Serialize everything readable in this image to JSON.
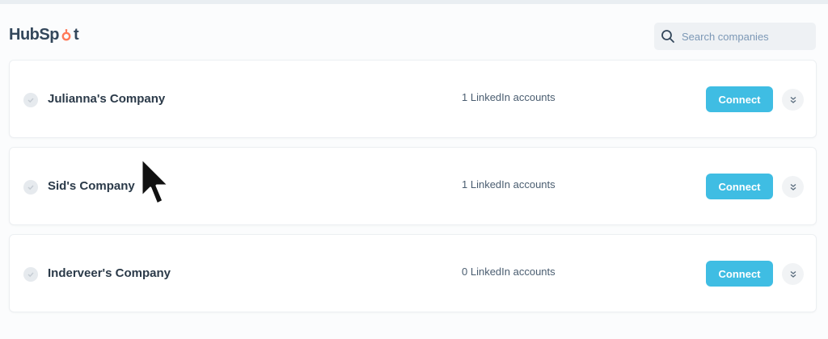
{
  "brand": {
    "logo_text_left": "HubSp",
    "logo_text_right": "t"
  },
  "search": {
    "placeholder": "Search companies",
    "value": ""
  },
  "companies": [
    {
      "name": "Julianna's Company",
      "accounts": "1 LinkedIn accounts",
      "connect_label": "Connect"
    },
    {
      "name": "Sid's Company",
      "accounts": "1 LinkedIn accounts",
      "connect_label": "Connect"
    },
    {
      "name": "Inderveer's Company",
      "accounts": "0 LinkedIn accounts",
      "connect_label": "Connect"
    }
  ],
  "icons": {
    "search": "search-icon",
    "status": "check-circle-icon",
    "expand": "double-chevron-down-icon",
    "cursor": "mouse-pointer-icon"
  },
  "colors": {
    "accent": "#3fbde3",
    "hubspot_orange": "#ff7a59",
    "text_dark": "#2b3a49"
  }
}
